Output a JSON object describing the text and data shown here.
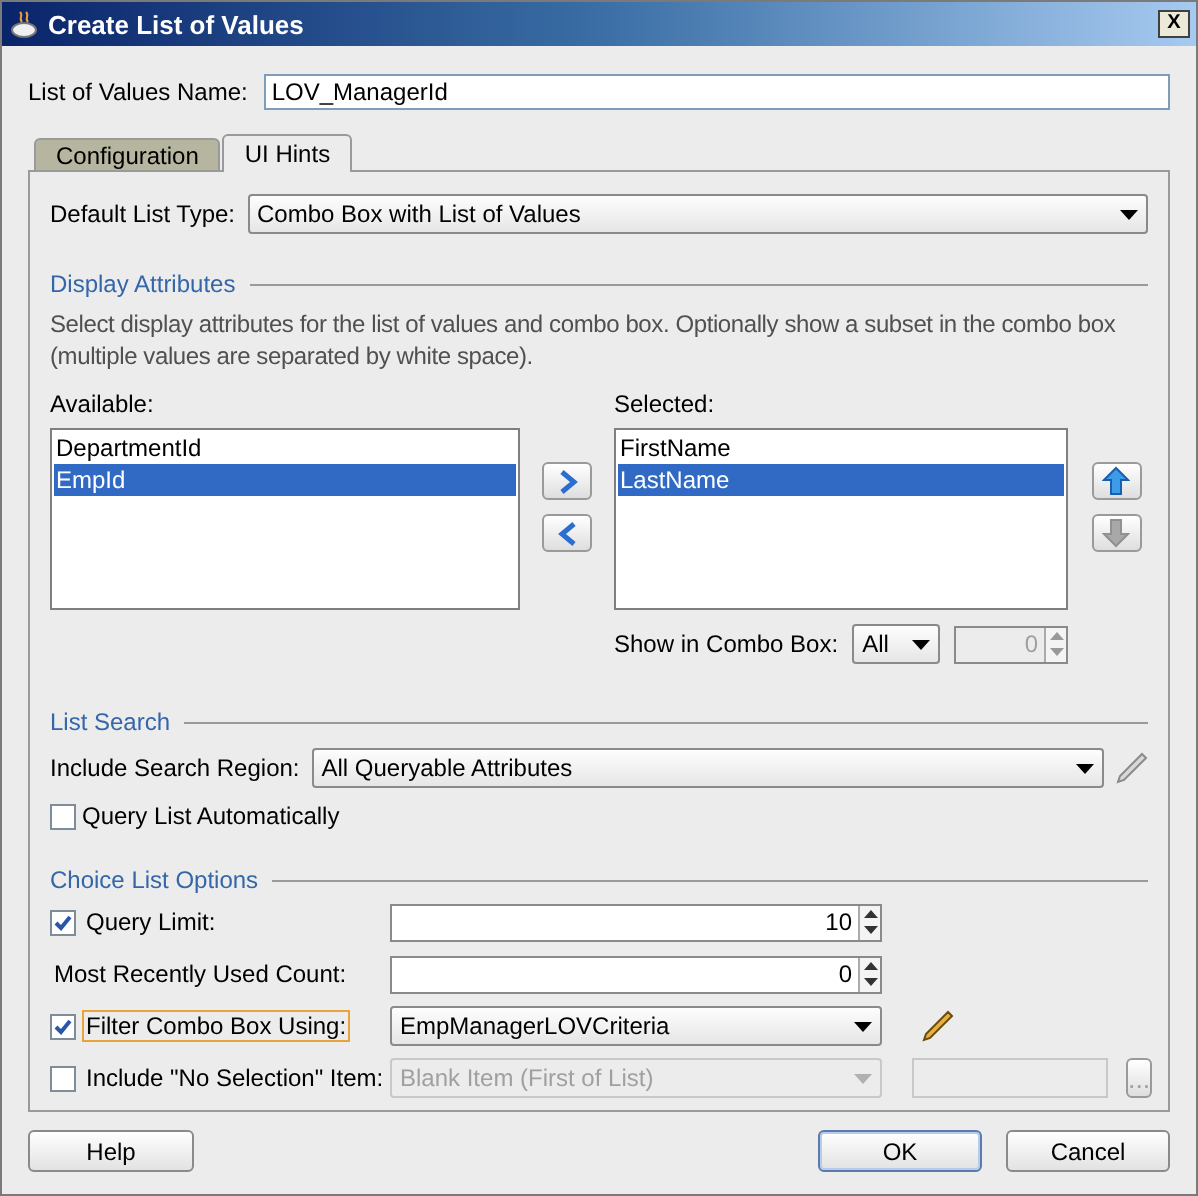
{
  "window": {
    "title": "Create List of Values",
    "close_label": "X"
  },
  "name_field": {
    "label": "List of Values Name:",
    "value": "LOV_ManagerId"
  },
  "tabs": [
    {
      "label": "Configuration",
      "selected": false
    },
    {
      "label": "UI Hints",
      "selected": true
    }
  ],
  "default_list_type": {
    "label": "Default List Type:",
    "value": "Combo Box with List of Values"
  },
  "display_attributes": {
    "heading": "Display Attributes",
    "description": "Select display attributes for the list of values and combo box. Optionally show a subset in the combo box (multiple values are separated by white space).",
    "available": {
      "label": "Available:",
      "items": [
        {
          "label": "DepartmentId",
          "selected": false
        },
        {
          "label": "EmpId",
          "selected": true
        }
      ]
    },
    "chosen": {
      "label": "Selected:",
      "items": [
        {
          "label": "FirstName",
          "selected": false
        },
        {
          "label": "LastName",
          "selected": true
        }
      ]
    },
    "order_buttons": [
      {
        "kind": "up",
        "disabled": false
      },
      {
        "kind": "down",
        "disabled": true
      }
    ],
    "show_in_combo": {
      "label": "Show in Combo Box:",
      "value": "All",
      "count": "0",
      "count_disabled": true
    }
  },
  "list_search": {
    "heading": "List Search",
    "region_label": "Include Search Region:",
    "region_value": "All Queryable Attributes",
    "edit_disabled": true,
    "query_auto": {
      "label": "Query List Automatically",
      "checked": false
    }
  },
  "choice_list": {
    "heading": "Choice List Options",
    "rows": [
      {
        "kind": "spinner",
        "label": "Query Limit:",
        "checked": true,
        "value": "10"
      },
      {
        "kind": "spinner",
        "label": "Most Recently Used Count:",
        "value": "0"
      },
      {
        "kind": "combo",
        "label": "Filter Combo Box Using:",
        "checked": true,
        "focused": true,
        "value": "EmpManagerLOVCriteria",
        "disabled": false,
        "edit_disabled": false
      },
      {
        "kind": "combo_text",
        "label": "Include \"No Selection\" Item:",
        "checked": false,
        "focused": false,
        "value": "Blank Item (First of List)",
        "disabled": true,
        "browse_label": "..."
      }
    ]
  },
  "buttons": [
    {
      "label": "Help",
      "default": false
    },
    {
      "label": "OK",
      "default": true
    },
    {
      "label": "Cancel",
      "default": false
    }
  ]
}
